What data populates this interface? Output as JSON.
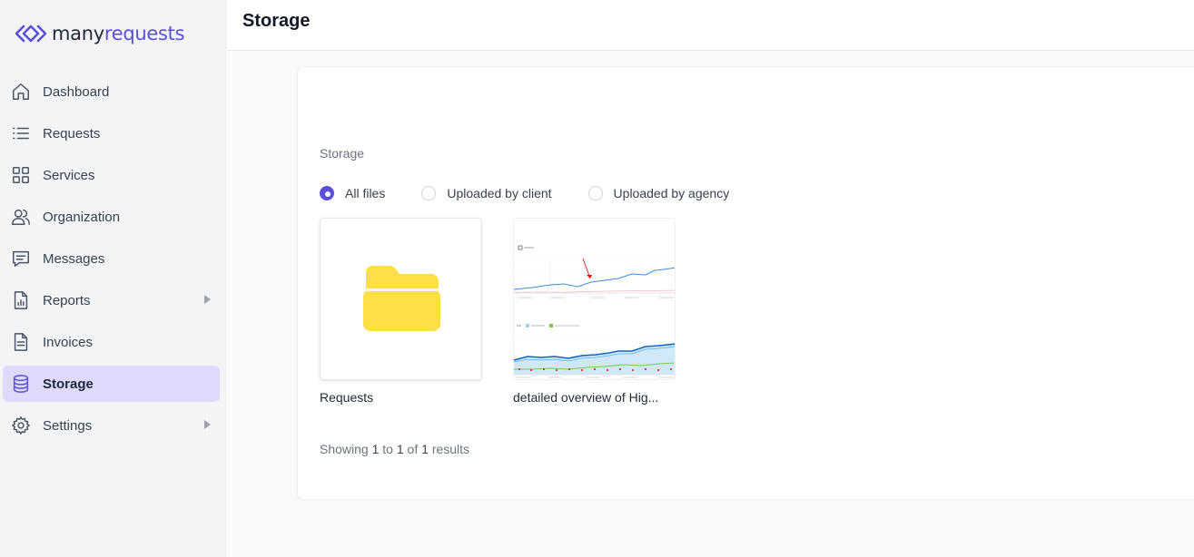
{
  "app": {
    "brand_part1": "many",
    "brand_part2": "requests",
    "brand_color": "#5b4fdc"
  },
  "sidebar": {
    "items": [
      {
        "label": "Dashboard",
        "icon": "home-icon",
        "active": false,
        "submenu": false
      },
      {
        "label": "Requests",
        "icon": "list-icon",
        "active": false,
        "submenu": false
      },
      {
        "label": "Services",
        "icon": "grid-icon",
        "active": false,
        "submenu": false
      },
      {
        "label": "Organization",
        "icon": "users-icon",
        "active": false,
        "submenu": false
      },
      {
        "label": "Messages",
        "icon": "chat-icon",
        "active": false,
        "submenu": false
      },
      {
        "label": "Reports",
        "icon": "report-icon",
        "active": false,
        "submenu": true
      },
      {
        "label": "Invoices",
        "icon": "invoice-icon",
        "active": false,
        "submenu": false
      },
      {
        "label": "Storage",
        "icon": "database-icon",
        "active": true,
        "submenu": false
      },
      {
        "label": "Settings",
        "icon": "gear-icon",
        "active": false,
        "submenu": true
      }
    ]
  },
  "header": {
    "title": "Storage"
  },
  "main": {
    "section_label": "Storage",
    "filters": [
      {
        "label": "All files",
        "checked": true
      },
      {
        "label": "Uploaded by client",
        "checked": false
      },
      {
        "label": "Uploaded by agency",
        "checked": false
      }
    ],
    "files": [
      {
        "name": "Requests",
        "type": "folder",
        "icon": "folder-icon"
      },
      {
        "name": "detailed overview of Hig...",
        "type": "image",
        "icon": "chart-thumbnail"
      }
    ],
    "pagination": {
      "prefix": "Showing",
      "from": "1",
      "to_word": "to",
      "to": "1",
      "of_word": "of",
      "total": "1",
      "suffix": "results"
    }
  }
}
